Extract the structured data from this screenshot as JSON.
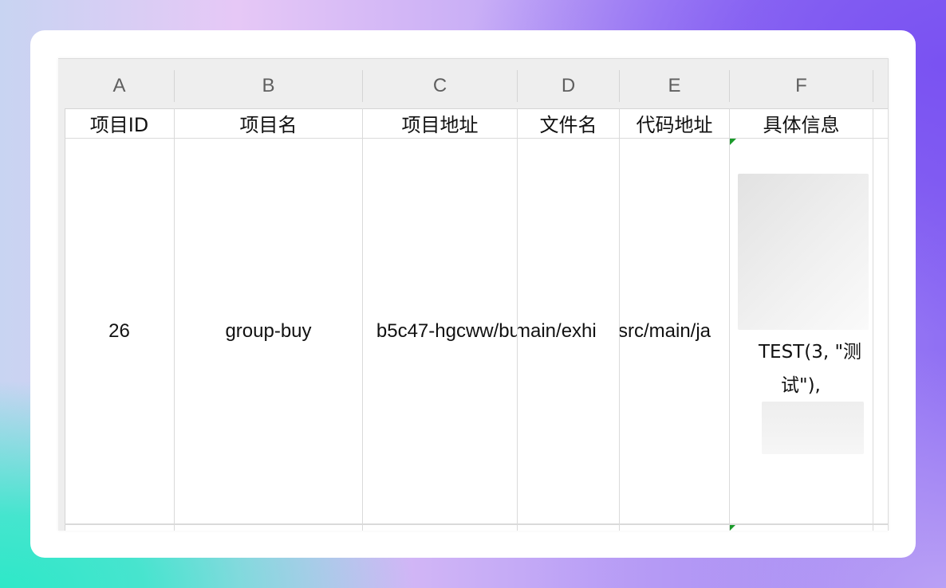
{
  "spreadsheet": {
    "columns": [
      "A",
      "B",
      "C",
      "D",
      "E",
      "F"
    ],
    "headers": [
      "项目ID",
      "项目名",
      "项目地址",
      "文件名",
      "代码地址",
      "具体信息"
    ],
    "row": {
      "project_id": "26",
      "project_name": "group-buy",
      "project_url": "b5c47-hgcww/bu",
      "file_name": "main/exhi",
      "code_url": "src/main/ja",
      "detail_line1": "TEST(3, \"测",
      "detail_line2": "试\"),"
    },
    "colors": {
      "comment_marker": "#1a9a2a",
      "grid_line": "#dadada",
      "header_bg": "#eeeeee"
    }
  }
}
